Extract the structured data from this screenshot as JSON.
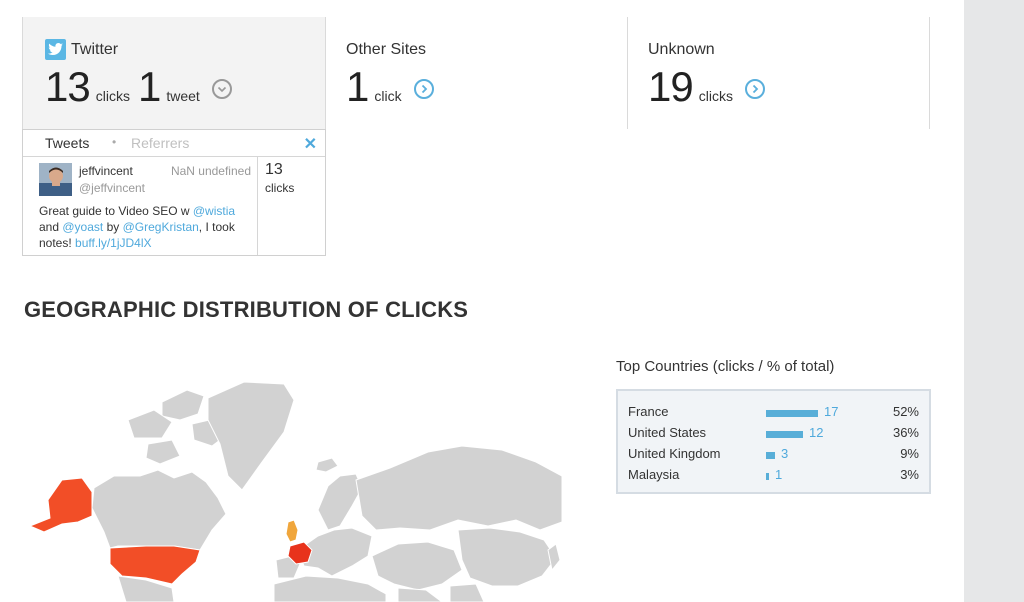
{
  "cards": {
    "twitter": {
      "title": "Twitter",
      "clicks_value": "13",
      "clicks_unit": "clicks",
      "tweets_value": "1",
      "tweets_unit": "tweet"
    },
    "other": {
      "title": "Other Sites",
      "value": "1",
      "unit": "click"
    },
    "unknown": {
      "title": "Unknown",
      "value": "19",
      "unit": "clicks"
    }
  },
  "tweets_panel": {
    "tabs": [
      "Tweets",
      "Referrers"
    ],
    "separator": "•",
    "close_glyph": "✕",
    "tweet": {
      "username": "jeffvincent",
      "handle": "@jeffvincent",
      "date": "NaN undefined",
      "text_parts": [
        "Great guide to Video SEO w ",
        "@wistia",
        " and ",
        "@yoast",
        " by ",
        "@GregKristan",
        ", I took notes! ",
        "buff.ly/1jJD4lX"
      ],
      "clicks_value": "13",
      "clicks_label": "clicks"
    }
  },
  "geo": {
    "title": "GEOGRAPHIC DISTRIBUTION OF CLICKS",
    "highlight_colors": {
      "high": "#e8331c",
      "mid": "#f24e27",
      "low": "#f0a63c",
      "none": "#d2d2d2"
    }
  },
  "top_countries": {
    "title": "Top Countries (clicks / % of total)",
    "bar_color": "#58aed8",
    "rows": [
      {
        "name": "France",
        "count": "17",
        "count_num": 17,
        "pct": "52%"
      },
      {
        "name": "United States",
        "count": "12",
        "count_num": 12,
        "pct": "36%"
      },
      {
        "name": "United Kingdom",
        "count": "3",
        "count_num": 3,
        "pct": "9%"
      },
      {
        "name": "Malaysia",
        "count": "1",
        "count_num": 1,
        "pct": "3%"
      }
    ]
  }
}
